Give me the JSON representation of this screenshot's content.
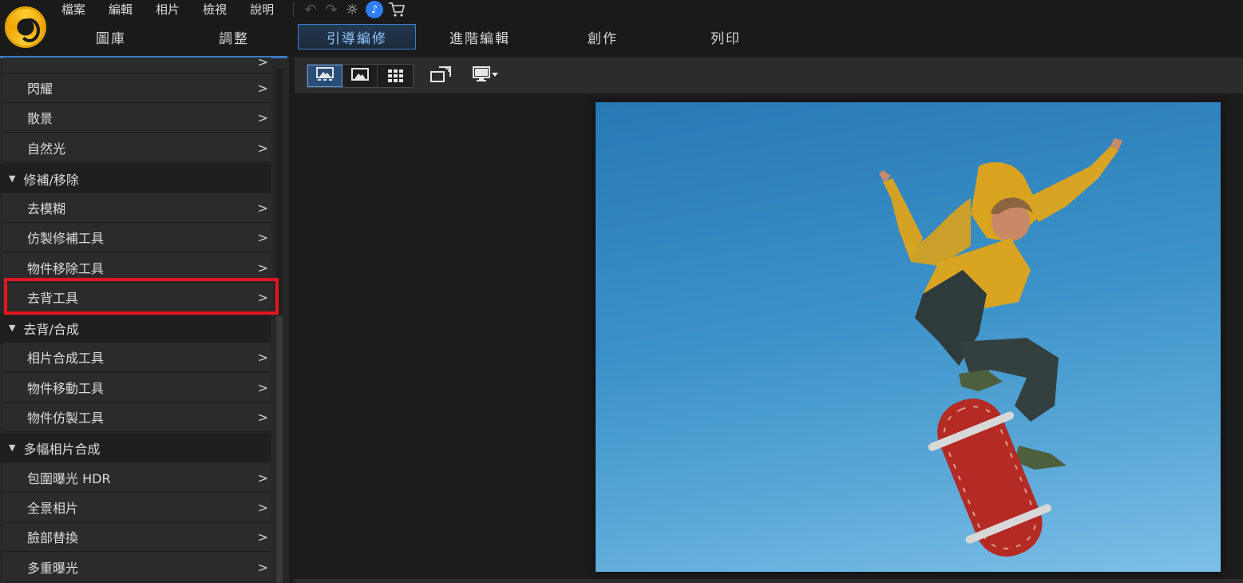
{
  "app": {
    "menu": [
      "檔案",
      "編輯",
      "相片",
      "檢視",
      "說明"
    ]
  },
  "toolbar_icons": [
    "undo-icon",
    "redo-icon",
    "settings-icon",
    "notification-icon",
    "cart-icon"
  ],
  "tabs": [
    {
      "label": "圖庫"
    },
    {
      "label": "調整"
    },
    {
      "label": "引導編修",
      "active": true
    },
    {
      "label": "進階編輯"
    },
    {
      "label": "創作"
    },
    {
      "label": "列印"
    }
  ],
  "sidebar": {
    "items": [
      {
        "label": "閃耀",
        "type": "item"
      },
      {
        "label": "散景",
        "type": "item"
      },
      {
        "label": "自然光",
        "type": "item"
      },
      {
        "label": "修補/移除",
        "type": "group"
      },
      {
        "label": "去模糊",
        "type": "item"
      },
      {
        "label": "仿製修補工具",
        "type": "item"
      },
      {
        "label": "物件移除工具",
        "type": "item"
      },
      {
        "label": "去背工具",
        "type": "item",
        "highlighted": true
      },
      {
        "label": "去背/合成",
        "type": "group"
      },
      {
        "label": "相片合成工具",
        "type": "item"
      },
      {
        "label": "物件移動工具",
        "type": "item"
      },
      {
        "label": "物件仿製工具",
        "type": "item"
      },
      {
        "label": "多幅相片合成",
        "type": "group"
      },
      {
        "label": "包圍曝光 HDR",
        "type": "item"
      },
      {
        "label": "全景相片",
        "type": "item"
      },
      {
        "label": "臉部替換",
        "type": "item"
      },
      {
        "label": "多重曝光",
        "type": "item"
      }
    ],
    "highlight_color": "#e2161f"
  },
  "viewer": {
    "view_modes": [
      "single-view-icon",
      "compare-view-icon",
      "grid-view-icon"
    ],
    "extra_buttons": [
      "fit-screen-icon",
      "display-dropdown-icon"
    ],
    "photo_description_color": "#3b92c8"
  },
  "colors": {
    "accent": "#3a7fd0",
    "highlight": "#e2161f"
  }
}
